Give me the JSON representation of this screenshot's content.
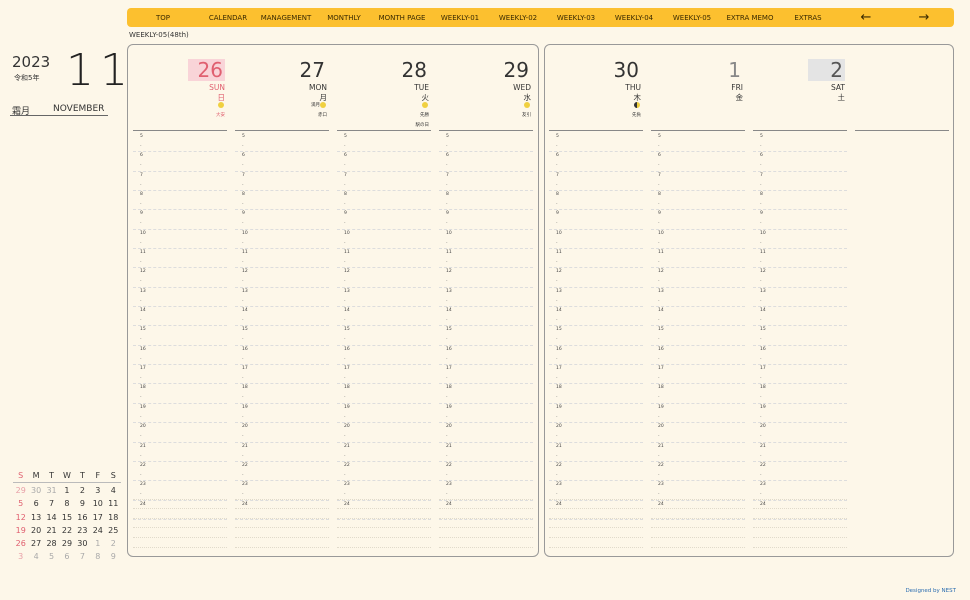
{
  "nav": {
    "items": [
      "TOP",
      "CALENDAR",
      "MANAGEMENT",
      "MONTHLY",
      "MONTH PAGE",
      "WEEKLY-01",
      "WEEKLY-02",
      "WEEKLY-03",
      "WEEKLY-04",
      "WEEKLY-05",
      "EXTRA MEMO",
      "EXTRAS"
    ],
    "prev_arrow": "←",
    "next_arrow": "→"
  },
  "week_label": "WEEKLY-05(48th)",
  "header": {
    "year": "2023",
    "era": "令和5年",
    "month_num": "11",
    "month_jp": "霜月",
    "month_en": "NOVEMBER"
  },
  "mini_cal": {
    "weekdays": [
      "S",
      "M",
      "T",
      "W",
      "T",
      "F",
      "S"
    ],
    "weeks": [
      [
        "29",
        "30",
        "31",
        "1",
        "2",
        "3",
        "4"
      ],
      [
        "5",
        "6",
        "7",
        "8",
        "9",
        "10",
        "11"
      ],
      [
        "12",
        "13",
        "14",
        "15",
        "16",
        "17",
        "18"
      ],
      [
        "19",
        "20",
        "21",
        "22",
        "23",
        "24",
        "25"
      ],
      [
        "26",
        "27",
        "28",
        "29",
        "30",
        "1",
        "2"
      ],
      [
        "3",
        "4",
        "5",
        "6",
        "7",
        "8",
        "9"
      ]
    ]
  },
  "days": [
    {
      "num": "26",
      "en": "SUN",
      "jp": "日",
      "rokuyo": "大安",
      "moon": "full",
      "moon_label": "",
      "holiday": "",
      "style": "sun"
    },
    {
      "num": "27",
      "en": "MON",
      "jp": "月",
      "rokuyo": "赤口",
      "moon": "full",
      "moon_label": "満月",
      "holiday": "",
      "style": ""
    },
    {
      "num": "28",
      "en": "TUE",
      "jp": "火",
      "rokuyo": "先勝",
      "moon": "full",
      "moon_label": "",
      "holiday": "駅の日",
      "style": ""
    },
    {
      "num": "29",
      "en": "WED",
      "jp": "水",
      "rokuyo": "友引",
      "moon": "full",
      "moon_label": "",
      "holiday": "",
      "style": ""
    },
    {
      "num": "30",
      "en": "THU",
      "jp": "木",
      "rokuyo": "先負",
      "moon": "half",
      "moon_label": "",
      "holiday": "",
      "style": ""
    },
    {
      "num": "1",
      "en": "FRI",
      "jp": "金",
      "rokuyo": "",
      "moon": "",
      "moon_label": "",
      "holiday": "",
      "style": "dim"
    },
    {
      "num": "2",
      "en": "SAT",
      "jp": "土",
      "rokuyo": "",
      "moon": "",
      "moon_label": "",
      "holiday": "",
      "style": "sat"
    }
  ],
  "hours": [
    "5",
    "6",
    "7",
    "8",
    "9",
    "10",
    "11",
    "12",
    "13",
    "14",
    "15",
    "16",
    "17",
    "18",
    "19",
    "20",
    "21",
    "22",
    "23",
    "24"
  ],
  "hour_dash": "-",
  "footer": "Designed by NEST",
  "colors": {
    "nav_bg": "#fcc02f",
    "page_bg": "#fdf7e9",
    "sunday": "#e06070",
    "saturday_bg": "#e4e4e4",
    "sunday_bg": "#f9d4d8"
  }
}
